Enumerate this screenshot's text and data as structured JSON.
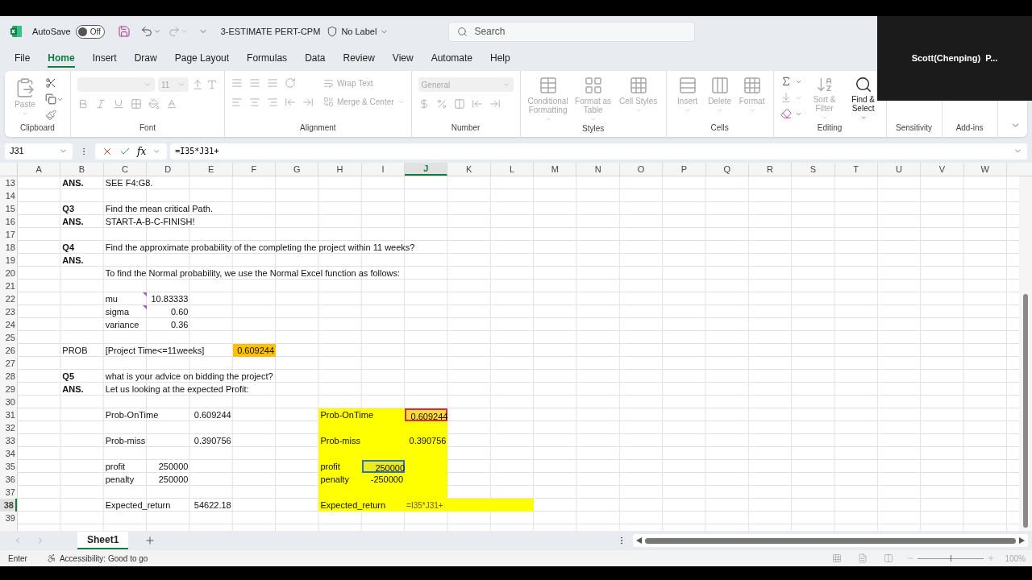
{
  "title_bar": {
    "autosave_label": "AutoSave",
    "autosave": {
      "on": false,
      "text": "Off"
    },
    "title": "3-ESTIMATE PERT-CPM",
    "label_button": "No Label",
    "search": {
      "placeholder": "Search"
    }
  },
  "menu": [
    {
      "label": "File",
      "selected": false
    },
    {
      "label": "Home",
      "selected": true
    },
    {
      "label": "Insert",
      "selected": false
    },
    {
      "label": "Draw",
      "selected": false
    },
    {
      "label": "Page Layout",
      "selected": false
    },
    {
      "label": "Formulas",
      "selected": false
    },
    {
      "label": "Data",
      "selected": false
    },
    {
      "label": "Review",
      "selected": false
    },
    {
      "label": "View",
      "selected": false
    },
    {
      "label": "Automate",
      "selected": false
    },
    {
      "label": "Help",
      "selected": false
    }
  ],
  "ribbon": {
    "groups": [
      {
        "kind": "clipboard",
        "label": "Clipboard",
        "buttons": [
          {
            "label": "Paste",
            "disabled": true
          }
        ]
      },
      {
        "kind": "font",
        "label": "Font",
        "buttons": [
          {
            "label": "11",
            "disabled": true
          }
        ]
      },
      {
        "kind": "alignment",
        "label": "Alignment",
        "buttons": [
          {
            "label": "Wrap Text",
            "disabled": true
          },
          {
            "label": "Merge & Center",
            "disabled": true
          }
        ]
      },
      {
        "kind": "number",
        "label": "Number",
        "buttons": [
          {
            "label": "General",
            "disabled": true
          }
        ]
      },
      {
        "kind": "styles",
        "label": "Styles",
        "buttons": [
          {
            "label": "Conditional Formatting",
            "disabled": true
          },
          {
            "label": "Format as Table",
            "disabled": true
          },
          {
            "label": "Cell Styles",
            "disabled": true
          }
        ]
      },
      {
        "kind": "cells",
        "label": "Cells",
        "buttons": [
          {
            "label": "Insert",
            "disabled": true
          },
          {
            "label": "Delete",
            "disabled": true
          },
          {
            "label": "Format",
            "disabled": true
          }
        ]
      },
      {
        "kind": "editing",
        "label": "Editing",
        "buttons": [
          {
            "label": "Sort & Filter",
            "disabled": true
          },
          {
            "label": "Find & Select",
            "disabled": false
          }
        ]
      },
      {
        "kind": "plain",
        "label": "Sensitivity"
      },
      {
        "kind": "plain",
        "label": "Add-ins"
      }
    ]
  },
  "formula_bar": {
    "name_box": "J31",
    "fx": "fx",
    "formula": "=I35*J31+"
  },
  "columns": [
    {
      "label": "A",
      "selected": false
    },
    {
      "label": "B",
      "selected": false
    },
    {
      "label": "C",
      "selected": false
    },
    {
      "label": "D",
      "selected": false
    },
    {
      "label": "E",
      "selected": false
    },
    {
      "label": "F",
      "selected": false
    },
    {
      "label": "G",
      "selected": false
    },
    {
      "label": "H",
      "selected": false
    },
    {
      "label": "I",
      "selected": false
    },
    {
      "label": "J",
      "selected": true
    },
    {
      "label": "K",
      "selected": false
    },
    {
      "label": "L",
      "selected": false
    },
    {
      "label": "M",
      "selected": false
    },
    {
      "label": "N",
      "selected": false
    },
    {
      "label": "O",
      "selected": false
    },
    {
      "label": "P",
      "selected": false
    },
    {
      "label": "Q",
      "selected": false
    },
    {
      "label": "R",
      "selected": false
    },
    {
      "label": "S",
      "selected": false
    },
    {
      "label": "T",
      "selected": false
    },
    {
      "label": "U",
      "selected": false
    },
    {
      "label": "V",
      "selected": false
    },
    {
      "label": "W",
      "selected": false
    }
  ],
  "rows": [
    {
      "number": "13",
      "selected": false,
      "cells": {
        "B": {
          "text": "ANS.",
          "bold": true,
          "kind": "text"
        },
        "C": {
          "text": "SEE F4:G8.",
          "bold": false,
          "kind": "text"
        }
      }
    },
    {
      "number": "14",
      "selected": false,
      "cells": {}
    },
    {
      "number": "15",
      "selected": false,
      "cells": {
        "B": {
          "text": "Q3",
          "bold": true,
          "kind": "text"
        },
        "C": {
          "text": "Find the mean critical Path.",
          "bold": false,
          "kind": "text"
        }
      }
    },
    {
      "number": "16",
      "selected": false,
      "cells": {
        "B": {
          "text": "ANS.",
          "bold": true,
          "kind": "text"
        },
        "C": {
          "text": "START-A-B-C-FINISH!",
          "bold": false,
          "kind": "text"
        }
      }
    },
    {
      "number": "17",
      "selected": false,
      "cells": {}
    },
    {
      "number": "18",
      "selected": false,
      "cells": {
        "B": {
          "text": "Q4",
          "bold": true,
          "kind": "text"
        },
        "C": {
          "text": "Find the approximate probability of the completing the project within 11 weeks?",
          "bold": false,
          "kind": "text"
        }
      }
    },
    {
      "number": "19",
      "selected": false,
      "cells": {
        "B": {
          "text": "ANS.",
          "bold": true,
          "kind": "text"
        }
      }
    },
    {
      "number": "20",
      "selected": false,
      "cells": {
        "C": {
          "text": "To find the Normal probability, we use the Normal Excel function as follows:",
          "bold": false,
          "kind": "text"
        }
      }
    },
    {
      "number": "21",
      "selected": false,
      "cells": {}
    },
    {
      "number": "22",
      "selected": false,
      "cells": {
        "C": {
          "text": "mu",
          "bold": false,
          "kind": "text",
          "comment": true
        },
        "D": {
          "text": "10.83333",
          "kind": "number"
        }
      }
    },
    {
      "number": "23",
      "selected": false,
      "cells": {
        "C": {
          "text": "sigma",
          "bold": false,
          "kind": "text",
          "comment": true
        },
        "D": {
          "text": "0.60",
          "kind": "number"
        }
      }
    },
    {
      "number": "24",
      "selected": false,
      "cells": {
        "C": {
          "text": "variance",
          "bold": false,
          "kind": "text"
        },
        "D": {
          "text": "0.36",
          "kind": "number"
        }
      }
    },
    {
      "number": "25",
      "selected": false,
      "cells": {}
    },
    {
      "number": "26",
      "selected": false,
      "cells": {
        "B": {
          "text": "PROB",
          "bold": false,
          "kind": "text"
        },
        "C": {
          "text": "[Project Time<=11weeks]",
          "bold": false,
          "kind": "text"
        },
        "F": {
          "text": "0.609244",
          "kind": "number",
          "color": "#ffc000"
        }
      }
    },
    {
      "number": "27",
      "selected": false,
      "cells": {}
    },
    {
      "number": "28",
      "selected": false,
      "cells": {
        "B": {
          "text": "Q5",
          "bold": true,
          "kind": "text"
        },
        "C": {
          "text": "what is your advice on bidding the project?",
          "bold": false,
          "kind": "text"
        }
      }
    },
    {
      "number": "29",
      "selected": false,
      "cells": {
        "B": {
          "text": "ANS.",
          "bold": true,
          "kind": "text"
        },
        "C": {
          "text": "Let us looking at the expected Profit:",
          "bold": false,
          "kind": "text"
        }
      }
    },
    {
      "number": "30",
      "selected": false,
      "cells": {}
    },
    {
      "number": "31",
      "selected": false,
      "cells": {
        "C": {
          "text": "Prob-OnTime",
          "kind": "text"
        },
        "E": {
          "text": "0.609244",
          "kind": "number"
        },
        "H": {
          "text": "Prob-OnTime",
          "kind": "text",
          "color": "#ffff00"
        },
        "I": {
          "color": "#ffff00"
        },
        "J": {
          "text": "0.609244",
          "kind": "number",
          "color": "#ffd93b",
          "outline": {
            "color": "#d13438"
          }
        }
      }
    },
    {
      "number": "32",
      "selected": false,
      "cells": {
        "H": {
          "color": "#ffff00"
        },
        "I": {
          "color": "#ffff00"
        },
        "J": {
          "color": "#ffff00"
        }
      }
    },
    {
      "number": "33",
      "selected": false,
      "cells": {
        "C": {
          "text": "Prob-miss",
          "kind": "text"
        },
        "E": {
          "text": "0.390756",
          "kind": "number"
        },
        "H": {
          "text": "Prob-miss",
          "kind": "text",
          "color": "#ffff00"
        },
        "I": {
          "color": "#ffff00"
        },
        "J": {
          "text": "0.390756",
          "kind": "number",
          "color": "#ffff00"
        }
      }
    },
    {
      "number": "34",
      "selected": false,
      "cells": {
        "H": {
          "color": "#ffff00"
        },
        "I": {
          "color": "#ffff00"
        },
        "J": {
          "color": "#ffff00"
        }
      }
    },
    {
      "number": "35",
      "selected": false,
      "cells": {
        "C": {
          "text": "profit",
          "kind": "text"
        },
        "D": {
          "text": "250000",
          "kind": "number"
        },
        "H": {
          "text": "profit",
          "kind": "text",
          "color": "#ffff00"
        },
        "I": {
          "text": "250000",
          "kind": "number",
          "color": "#eded1a",
          "outline": {
            "color": "#2f6fd6"
          }
        },
        "J": {
          "color": "#ffff00"
        }
      }
    },
    {
      "number": "36",
      "selected": false,
      "cells": {
        "C": {
          "text": "penalty",
          "kind": "text"
        },
        "D": {
          "text": "250000",
          "kind": "number"
        },
        "H": {
          "text": "penalty",
          "kind": "text",
          "color": "#ffff00"
        },
        "I": {
          "text": "-250000",
          "kind": "number",
          "color": "#ffff00"
        },
        "J": {
          "color": "#ffff00"
        }
      }
    },
    {
      "number": "37",
      "selected": false,
      "cells": {
        "H": {
          "color": "#ffff00"
        },
        "I": {
          "color": "#ffff00"
        },
        "J": {
          "color": "#ffff00"
        }
      }
    },
    {
      "number": "38",
      "selected": true,
      "cells": {
        "C": {
          "text": "Expected_return",
          "kind": "text"
        },
        "E": {
          "text": "54622.18",
          "kind": "number"
        },
        "H": {
          "text": "Expected_return",
          "kind": "text",
          "color": "#ffff00"
        },
        "I": {
          "color": "#ffff00"
        },
        "J": {
          "text": "=I35*J31+",
          "kind": "editing",
          "color": "#ffff00"
        },
        "K": {
          "color": "#ffff00"
        },
        "L": {
          "color": "#ffff00"
        }
      }
    },
    {
      "number": "39",
      "selected": false,
      "cells": {}
    }
  ],
  "sheet_tabs": [
    {
      "label": "Sheet1",
      "selected": true
    }
  ],
  "status_bar": {
    "mode": "Enter",
    "accessibility": "Accessibility: Good to go",
    "zoom": {
      "level": 0.5,
      "text": "100%"
    }
  },
  "video_overlay": {
    "name": "Scott(Chenping)  P..."
  }
}
